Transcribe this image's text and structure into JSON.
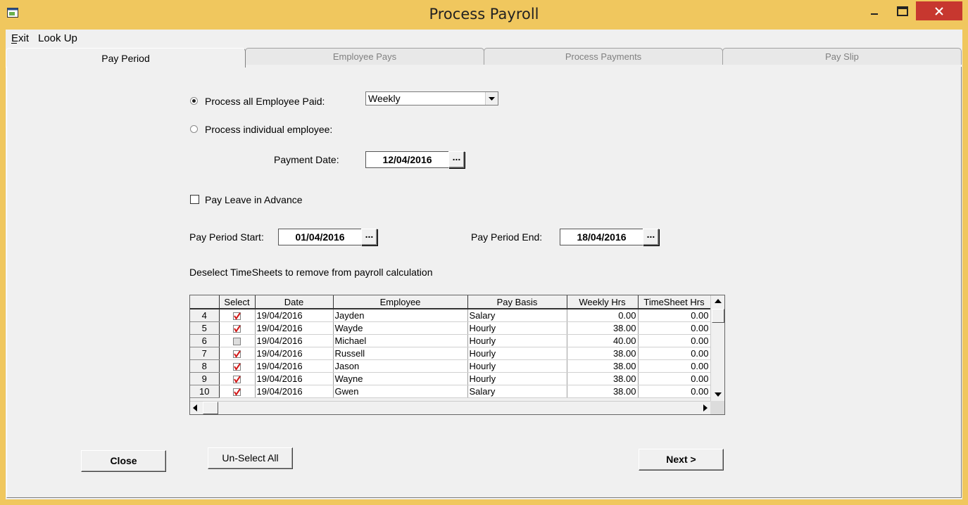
{
  "window": {
    "title": "Process Payroll"
  },
  "menu": {
    "exit": "Exit",
    "lookup": "Look Up"
  },
  "tabs": [
    {
      "label": "Pay Period"
    },
    {
      "label": "Employee Pays"
    },
    {
      "label": "Process Payments"
    },
    {
      "label": "Pay Slip"
    }
  ],
  "form": {
    "process_all_label": "Process all Employee Paid:",
    "frequency_value": "Weekly",
    "process_individual_label": "Process individual employee:",
    "payment_date_label": "Payment Date:",
    "payment_date_value": "12/04/2016",
    "pay_leave_label": "Pay Leave in Advance",
    "period_start_label": "Pay Period Start:",
    "period_start_value": "01/04/2016",
    "period_end_label": "Pay Period End:",
    "period_end_value": "18/04/2016",
    "deselect_label": "Deselect TimeSheets to remove from payroll calculation",
    "dots": "..."
  },
  "grid": {
    "headers": [
      "",
      "Select",
      "Date",
      "Employee",
      "Pay Basis",
      "Weekly Hrs",
      "TimeSheet Hrs"
    ],
    "rows": [
      {
        "num": "4",
        "selected": true,
        "date": "19/04/2016",
        "employee": "Jayden",
        "basis": "Salary",
        "weekly": "0.00",
        "timesheet": "0.00"
      },
      {
        "num": "5",
        "selected": true,
        "date": "19/04/2016",
        "employee": "Wayde",
        "basis": "Hourly",
        "weekly": "38.00",
        "timesheet": "0.00"
      },
      {
        "num": "6",
        "selected": false,
        "date": "19/04/2016",
        "employee": "Michael",
        "basis": "Hourly",
        "weekly": "40.00",
        "timesheet": "0.00"
      },
      {
        "num": "7",
        "selected": true,
        "date": "19/04/2016",
        "employee": "Russell",
        "basis": "Hourly",
        "weekly": "38.00",
        "timesheet": "0.00"
      },
      {
        "num": "8",
        "selected": true,
        "date": "19/04/2016",
        "employee": "Jason",
        "basis": "Hourly",
        "weekly": "38.00",
        "timesheet": "0.00"
      },
      {
        "num": "9",
        "selected": true,
        "date": "19/04/2016",
        "employee": "Wayne",
        "basis": "Hourly",
        "weekly": "38.00",
        "timesheet": "0.00"
      },
      {
        "num": "10",
        "selected": true,
        "date": "19/04/2016",
        "employee": "Gwen",
        "basis": "Salary",
        "weekly": "38.00",
        "timesheet": "0.00"
      }
    ]
  },
  "buttons": {
    "close": "Close",
    "unselect_all": "Un-Select All",
    "next": "Next >"
  },
  "colors": {
    "frame": "#f0c75e",
    "close_button": "#c7372f",
    "check_red": "#d11a1a"
  }
}
